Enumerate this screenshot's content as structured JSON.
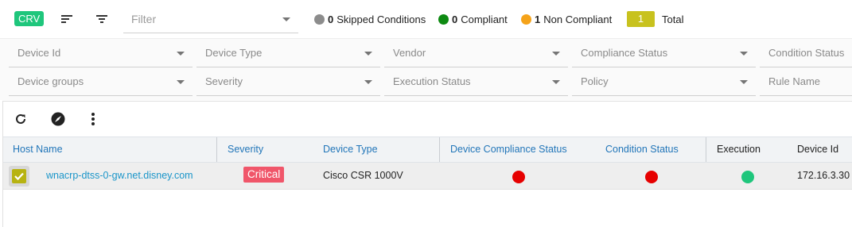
{
  "topbar": {
    "app_badge": "CRV",
    "filter_placeholder": "Filter",
    "legend": {
      "skipped_count": "0",
      "skipped_label": "Skipped Conditions",
      "skipped_color": "#8c8c8c",
      "compliant_count": "0",
      "compliant_label": "Compliant",
      "compliant_color": "#0e8a12",
      "noncompliant_count": "1",
      "noncompliant_label": "Non Compliant",
      "noncompliant_color": "#f5a31a"
    },
    "total_count": "1",
    "total_label": "Total",
    "total_color": "#c8c21e"
  },
  "filters": {
    "row1": [
      "Device Id",
      "Device Type",
      "Vendor",
      "Compliance Status",
      "Condition Status"
    ],
    "row2": [
      "Device groups",
      "Severity",
      "Execution Status",
      "Policy",
      "Rule Name"
    ]
  },
  "toolbar_icons": [
    "refresh-icon",
    "compass-icon",
    "more-vert-icon"
  ],
  "grid": {
    "columns": [
      "Host Name",
      "Severity",
      "Device Type",
      "Device Compliance Status",
      "Condition Status",
      "Execution",
      "Device Id"
    ],
    "rows": [
      {
        "host": "wnacrp-dtss-0-gw.net.disney.com",
        "severity": "Critical",
        "device_type": "Cisco CSR 1000V",
        "compliance_color": "#e60000",
        "condition_color": "#e60000",
        "execution_color": "#1fc67c",
        "device_id": "172.16.3.30"
      }
    ]
  }
}
